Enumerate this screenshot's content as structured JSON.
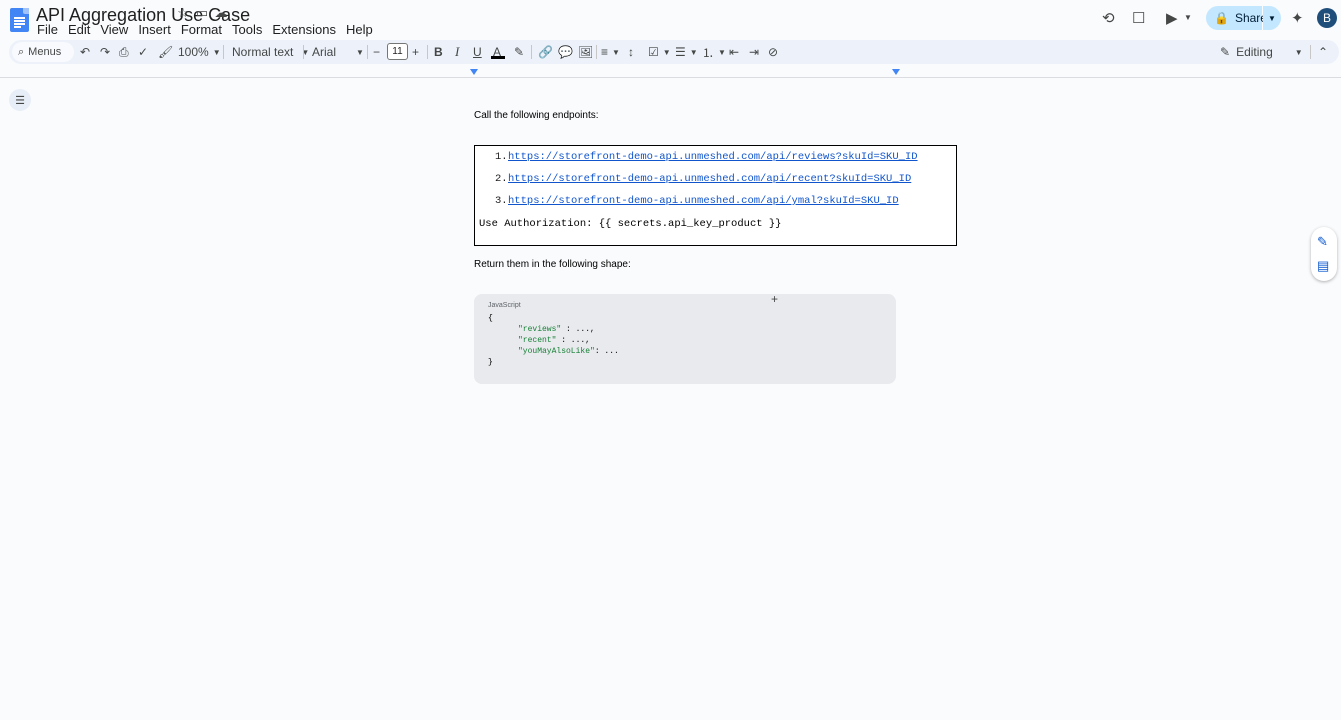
{
  "app": {
    "title": "API Aggregation Use Case",
    "menu": [
      "File",
      "Edit",
      "View",
      "Insert",
      "Format",
      "Tools",
      "Extensions",
      "Help"
    ],
    "share_label": "Share",
    "avatar_initial": "B"
  },
  "toolbar": {
    "menus_label": "Menus",
    "zoom": "100%",
    "style": "Normal text",
    "font": "Arial",
    "font_size": "11",
    "mode": "Editing"
  },
  "document": {
    "intro": "Call the following endpoints:",
    "endpoints": [
      {
        "num": "1.",
        "url": "https://storefront-demo-api.unmeshed.com/api/reviews?skuId=SKU_ID"
      },
      {
        "num": "2.",
        "url": "https://storefront-demo-api.unmeshed.com/api/recent?skuId=SKU_ID"
      },
      {
        "num": "3.",
        "url": "https://storefront-demo-api.unmeshed.com/api/ymal?skuId=SKU_ID"
      }
    ],
    "auth_line": "Use Authorization: {{ secrets.api_key_product }}",
    "return_text": "Return them in the following shape:",
    "snippet": {
      "language": "JavaScript",
      "open_brace": "{",
      "lines": [
        {
          "key": "\"reviews\"",
          "rest": " : ...,"
        },
        {
          "key": "\"recent\"",
          "rest": " : ...,"
        },
        {
          "key": "\"youMayAlsoLike\"",
          "rest": ": ..."
        }
      ],
      "close_brace": "}"
    }
  }
}
